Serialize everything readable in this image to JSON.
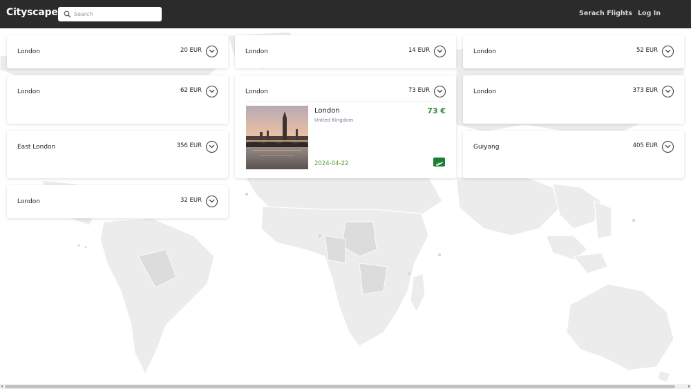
{
  "navbar": {
    "brand": "Cityscapes",
    "search_placeholder": "Search",
    "links": {
      "search_flights": "Serach Flights",
      "login": "Log In"
    }
  },
  "colors": {
    "navbar": "#2b2b2b",
    "price_accent": "#2e8b3a",
    "flight_icon": "#1d7f35"
  },
  "cards": [
    {
      "city": "London",
      "price": "20 EUR"
    },
    {
      "city": "London",
      "price": "14 EUR"
    },
    {
      "city": "London",
      "price": "52 EUR"
    },
    {
      "city": "London",
      "price": "62 EUR"
    },
    {
      "city": "London",
      "price": "73 EUR",
      "expanded": true
    },
    {
      "city": "London",
      "price": "373 EUR"
    },
    {
      "city": "East London",
      "price": "356 EUR"
    },
    {
      "city": "Guiyang",
      "price": "405 EUR"
    },
    {
      "city": "London",
      "price": "32 EUR"
    }
  ],
  "expanded_detail": {
    "city": "London",
    "country": "United Kingdom",
    "price": "73 €",
    "date": "2024-04-22",
    "image": "london-big-ben-thames-at-dusk",
    "action_icon": "plane-ticket-icon"
  }
}
